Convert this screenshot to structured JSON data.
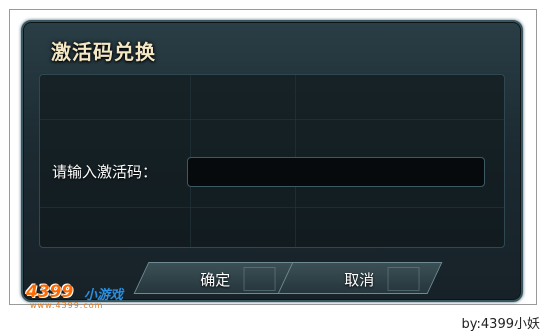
{
  "dialog": {
    "title": "激活码兑换",
    "prompt_label": "请输入激活码：",
    "code_input_value": "",
    "confirm_label": "确定",
    "cancel_label": "取消"
  },
  "watermark": {
    "logo_main": "4399",
    "logo_sub": "小游戏",
    "logo_url": "www.4399.com",
    "credit": "by:4399小妖"
  },
  "colors": {
    "title": "#f3e7c4",
    "dialog_bg": "#1c2a31",
    "logo_orange": "#ff6a00",
    "logo_blue": "#2a8fe0"
  }
}
